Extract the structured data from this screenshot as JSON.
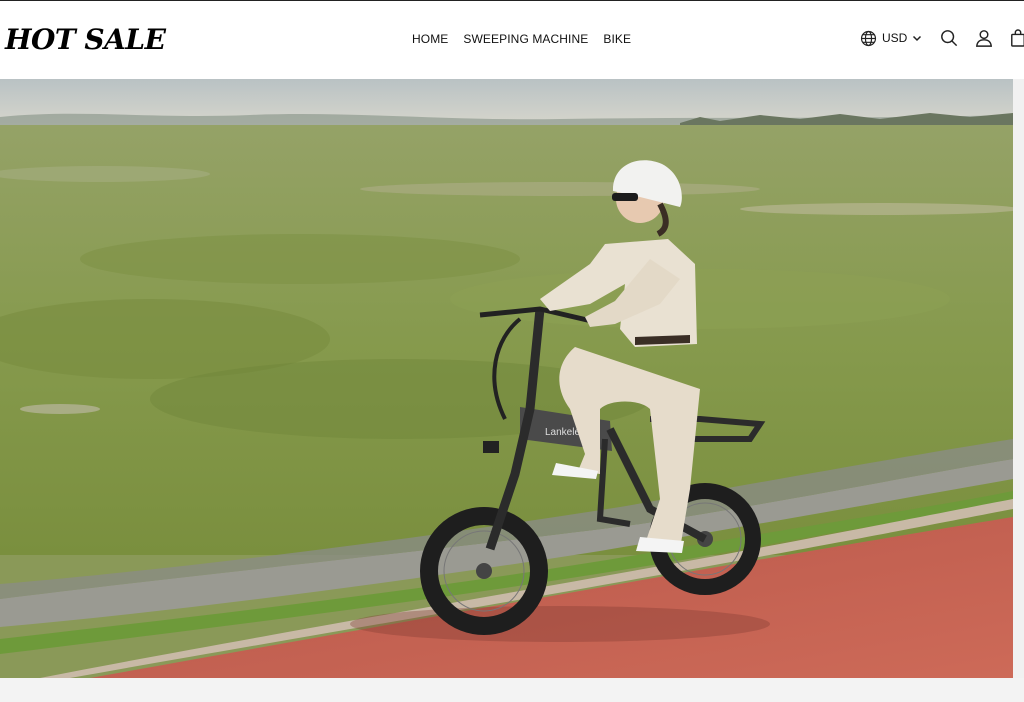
{
  "brand": {
    "logo_text": "HOT SALE"
  },
  "nav": {
    "items": [
      {
        "label": "HOME"
      },
      {
        "label": "SWEEPING MACHINE"
      },
      {
        "label": "BIKE"
      }
    ]
  },
  "header_tools": {
    "currency": "USD",
    "icons": [
      "globe-icon",
      "chevron-down-icon",
      "search-icon",
      "account-icon",
      "cart-icon"
    ]
  },
  "hero": {
    "image": "woman in white helmet riding a folding fat-tire e-bike on a red path beside a grassy field",
    "frame_text": "Lankeleisi"
  },
  "colors": {
    "header_bg": "#ffffff",
    "text": "#111111",
    "path_red": "#c45a4a",
    "grass": "#8a9958"
  }
}
